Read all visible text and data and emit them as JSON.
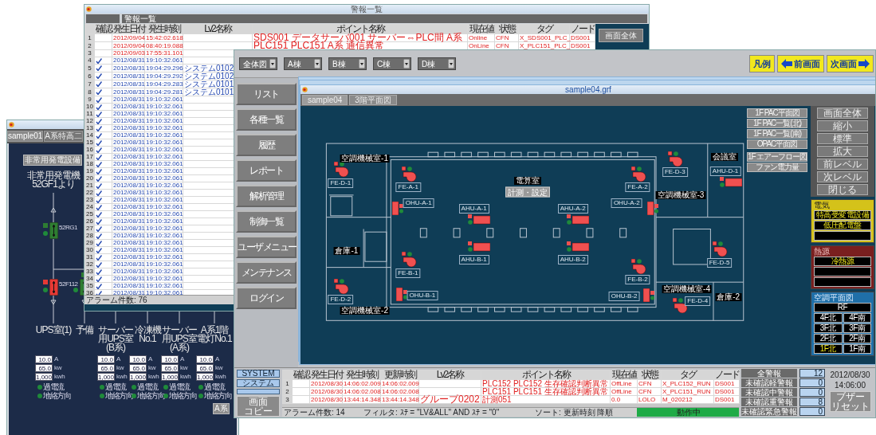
{
  "left_window": {
    "tabs": [
      {
        "label": "sample01",
        "selected": true
      },
      {
        "label": "A系特高二",
        "selected": false
      }
    ],
    "button": "非常用発電設備",
    "source_lines": [
      "非常用発電機",
      "52GF1より"
    ],
    "breakers": [
      {
        "label": "52RG1",
        "color": "#2e7d32"
      },
      {
        "label": "52F112",
        "color": "#e53935"
      },
      {
        "color": "#2e7d32"
      }
    ],
    "feeders": [
      {
        "name_lines": [
          "UPS室(1)"
        ],
        "readings": [
          {
            "value": "10.0",
            "unit": "A"
          },
          {
            "value": "65.0",
            "unit": "kw"
          },
          {
            "value": "1,000",
            "unit": "kwh"
          }
        ],
        "indicators": [
          "過電流",
          "地絡方向"
        ]
      },
      {
        "name_lines": [
          "予備"
        ]
      },
      {
        "name_lines": [
          "サーバー",
          "用UPS室",
          "(B系)"
        ],
        "readings": [
          {
            "value": "10.0",
            "unit": "A"
          },
          {
            "value": "65.0",
            "unit": "kw"
          },
          {
            "value": "1,000",
            "unit": "kwh"
          }
        ],
        "indicators": [
          "過電流",
          "地絡方向"
        ]
      },
      {
        "name_lines": [
          "冷凍機",
          "No.1"
        ],
        "readings": [
          {
            "value": "10.0",
            "unit": "A"
          },
          {
            "value": "65.0",
            "unit": "kw"
          },
          {
            "value": "1,000",
            "unit": "kwh"
          }
        ],
        "indicators": [
          "過電流",
          "地絡方向"
        ]
      },
      {
        "name_lines": [
          "サーバー",
          "用UPS室",
          "(A系)"
        ],
        "readings": [
          {
            "value": "10.0",
            "unit": "A"
          },
          {
            "value": "65.0",
            "unit": "kw"
          },
          {
            "value": "1,000",
            "unit": "kwh"
          }
        ],
        "indicators": [
          "過電流",
          "地絡方向"
        ]
      },
      {
        "name_lines": [
          "A系1階",
          "電灯No.1"
        ],
        "readings": [
          {
            "value": "10.0",
            "unit": "A"
          },
          {
            "value": "65.0",
            "unit": "kw"
          },
          {
            "value": "1,000",
            "unit": "kwh"
          }
        ],
        "indicators": [
          "過電流",
          "地絡方向"
        ]
      }
    ],
    "bottom_button": "A系"
  },
  "alarm_window": {
    "title": "警報一覧",
    "header": "警報一覧",
    "side_button": "画面全体",
    "columns": [
      "確認",
      "発生日付",
      "発生時刻",
      "Lv2名称",
      "ポイント名称",
      "現在値",
      "状態",
      "タグ",
      "ノード"
    ],
    "rows": [
      {
        "no": "1",
        "confirmed": false,
        "date": "2012/09/04",
        "time": "15:42:02.618",
        "point": "SDS001 データサーバ001 サーバー⇔PLC間 A系",
        "value": "Online",
        "state": "CFN",
        "tag": "X_SDS001_PLC_",
        "node": "DS001"
      },
      {
        "no": "2",
        "confirmed": false,
        "date": "2012/09/04",
        "time": "08:40:19.088",
        "point": "PLC151 PLC151 A系 通信異常",
        "value": "OnLine",
        "state": "CFN",
        "tag": "X_PLC151_PLC_",
        "node": "DS001"
      },
      {
        "no": "3",
        "confirmed": false,
        "date": "2012/09/03",
        "time": "17:55:31.101"
      },
      {
        "no": "4",
        "confirmed": true,
        "date": "2012/08/31",
        "time": "19:10:32.061"
      },
      {
        "no": "5",
        "confirmed": true,
        "date": "2012/08/31",
        "time": "19:04:29.296",
        "lv2": "システム0102"
      },
      {
        "no": "6",
        "confirmed": true,
        "date": "2012/08/31",
        "time": "19:04:29.292",
        "lv2": "システム0102"
      },
      {
        "no": "7",
        "confirmed": true,
        "date": "2012/08/31",
        "time": "19:04:29.283",
        "lv2": "システム0101"
      },
      {
        "no": "8",
        "confirmed": true,
        "date": "2012/08/31",
        "time": "19:04:29.281",
        "lv2": "システム0101"
      },
      {
        "no": "9",
        "confirmed": true,
        "date": "2012/08/31",
        "time": "19:10:32.061"
      },
      {
        "no": "10",
        "confirmed": true,
        "date": "2012/08/31",
        "time": "19:10:32.061"
      },
      {
        "no": "11",
        "confirmed": true,
        "date": "2012/08/31",
        "time": "19:10:32.061"
      },
      {
        "no": "12",
        "confirmed": true,
        "date": "2012/08/31",
        "time": "19:10:32.061"
      },
      {
        "no": "13",
        "confirmed": true,
        "date": "2012/08/31",
        "time": "19:10:32.061"
      },
      {
        "no": "14",
        "confirmed": true,
        "date": "2012/08/31",
        "time": "19:10:32.061"
      },
      {
        "no": "15",
        "confirmed": true,
        "date": "2012/08/31",
        "time": "19:10:32.061"
      },
      {
        "no": "16",
        "confirmed": true,
        "date": "2012/08/31",
        "time": "19:10:32.061"
      },
      {
        "no": "17",
        "confirmed": true,
        "date": "2012/08/31",
        "time": "19:10:32.061"
      },
      {
        "no": "18",
        "confirmed": true,
        "date": "2012/08/31",
        "time": "19:10:32.061"
      },
      {
        "no": "19",
        "confirmed": true,
        "date": "2012/08/31",
        "time": "19:10:32.061"
      },
      {
        "no": "20",
        "confirmed": true,
        "date": "2012/08/31",
        "time": "19:10:32.061"
      },
      {
        "no": "21",
        "confirmed": true,
        "date": "2012/08/31",
        "time": "19:10:32.061"
      },
      {
        "no": "22",
        "confirmed": true,
        "date": "2012/08/31",
        "time": "19:10:32.061"
      },
      {
        "no": "23",
        "confirmed": true,
        "date": "2012/08/31",
        "time": "19:10:32.061"
      },
      {
        "no": "24",
        "confirmed": true,
        "date": "2012/08/31",
        "time": "19:10:32.061"
      },
      {
        "no": "25",
        "confirmed": true,
        "date": "2012/08/31",
        "time": "19:10:32.061"
      },
      {
        "no": "26",
        "confirmed": true,
        "date": "2012/08/31",
        "time": "19:10:32.061"
      },
      {
        "no": "27",
        "confirmed": true,
        "date": "2012/08/31",
        "time": "19:10:32.061"
      },
      {
        "no": "28",
        "confirmed": true,
        "date": "2012/08/31",
        "time": "19:10:32.061"
      },
      {
        "no": "29",
        "confirmed": true,
        "date": "2012/08/31",
        "time": "19:10:32.061"
      },
      {
        "no": "30",
        "confirmed": true,
        "date": "2012/08/31",
        "time": "19:10:32.061"
      },
      {
        "no": "31",
        "confirmed": true,
        "date": "2012/08/31",
        "time": "19:10:32.061"
      },
      {
        "no": "32",
        "confirmed": true,
        "date": "2012/08/31",
        "time": "19:10:32.061"
      },
      {
        "no": "33",
        "confirmed": true,
        "date": "2012/08/31",
        "time": "19:10:32.061"
      },
      {
        "no": "34",
        "confirmed": true,
        "date": "2012/08/31",
        "time": "19:10:32.061"
      },
      {
        "no": "35",
        "confirmed": true,
        "date": "2012/08/31",
        "time": "19:10:32.061"
      },
      {
        "no": "36",
        "confirmed": true,
        "date": "2012/08/31",
        "time": "19:10:32.061"
      }
    ],
    "footer": "アラーム件数: 76"
  },
  "main_window": {
    "views": [
      "全体図",
      "A棟",
      "B棟",
      "C棟",
      "D棟"
    ],
    "nav_buttons": [
      {
        "kind": "legend",
        "label": "凡例"
      },
      {
        "kind": "back",
        "label": "前画面"
      },
      {
        "kind": "forward",
        "label": "次画面"
      }
    ],
    "menu": [
      "リスト",
      "各種一覧",
      "履歴",
      "レポート",
      "解析管理",
      "制御一覧",
      "ユーザメニュー",
      "メンテナンス",
      "ログイン"
    ],
    "sub_window": {
      "title": "sample04.grf",
      "tabs": [
        {
          "label": "sample04",
          "selected": true
        },
        {
          "label": "3階平面図",
          "selected": false
        }
      ],
      "labels": [
        {
          "kind": "room",
          "text": "空調機械室-1"
        },
        {
          "kind": "equipment",
          "text": "FE-D-1"
        },
        {
          "kind": "equipment",
          "text": "FE-A-1"
        },
        {
          "kind": "room",
          "text": "電算室"
        },
        {
          "kind": "equipment",
          "text": "FE-A-2"
        },
        {
          "kind": "equipment",
          "text": "FE-D-3"
        },
        {
          "kind": "room",
          "text": "会議室"
        },
        {
          "kind": "equipment",
          "text": "AHU-D-1"
        },
        {
          "kind": "room",
          "text": "空調機械室-3"
        },
        {
          "kind": "equipment",
          "text": "OHU-A-1"
        },
        {
          "kind": "equipment",
          "text": "AHU-A-1"
        },
        {
          "kind": "equipment",
          "text": "AHU-A-2"
        },
        {
          "kind": "equipment",
          "text": "OHU-A-2"
        },
        {
          "kind": "room",
          "text": "倉庫-1"
        },
        {
          "kind": "equipment",
          "text": "AHU-B-1"
        },
        {
          "kind": "equipment",
          "text": "AHU-B-2"
        },
        {
          "kind": "equipment",
          "text": "FE-B-1"
        },
        {
          "kind": "equipment",
          "text": "FE-B-2"
        },
        {
          "kind": "equipment",
          "text": "FE-D-5"
        },
        {
          "kind": "equipment",
          "text": "FE-D-2"
        },
        {
          "kind": "equipment",
          "text": "OHU-B-1"
        },
        {
          "kind": "equipment",
          "text": "OHU-B-2"
        },
        {
          "kind": "room",
          "text": "空調機械室-4"
        },
        {
          "kind": "equipment",
          "text": "FE-D-4"
        },
        {
          "kind": "room",
          "text": "倉庫-2"
        },
        {
          "kind": "room",
          "text": "空調機械室-2"
        }
      ],
      "measure_button": "計測・設定",
      "plan_buttons": [
        "1F PAC平面図",
        "1F PAC一覧(北)",
        "1F PAC一覧(南)",
        "OPAC平面図",
        "1F エアーフロー図",
        "ファン電力量"
      ],
      "view_buttons": [
        "画面全体",
        "縮小",
        "標準",
        "拡大",
        "前レベル",
        "次レベル",
        "閉じる"
      ],
      "panels": [
        {
          "kind": "electric",
          "title": "電気",
          "buttons": [
            "特高受変電設備",
            "低圧配電盤"
          ]
        },
        {
          "kind": "heat",
          "title": "熱源",
          "buttons": [
            "冷熱源"
          ]
        },
        {
          "kind": "hvac",
          "title": "空調平面図",
          "roof": "RF",
          "floors": [
            {
              "label": "4F北",
              "selected": false
            },
            {
              "label": "4F南",
              "selected": false
            },
            {
              "label": "3F北",
              "selected": false
            },
            {
              "label": "3F南",
              "selected": false
            },
            {
              "label": "2F北",
              "selected": false
            },
            {
              "label": "2F南",
              "selected": false
            },
            {
              "label": "1F北",
              "selected": true
            },
            {
              "label": "1F南",
              "selected": false
            }
          ]
        }
      ]
    },
    "side_buttons": [
      {
        "kind": "tab",
        "lines": [
          "SYSTEM"
        ]
      },
      {
        "kind": "tab",
        "lines": [
          "システム"
        ]
      },
      {
        "kind": "tab"
      },
      {
        "kind": "action",
        "lines": [
          "画面",
          "コピー"
        ]
      }
    ],
    "alarm_table": {
      "columns": [
        "確認",
        "発生日付",
        "発生時刻",
        "更新時刻",
        "Lv2名称",
        "ポイント名称",
        "現在値",
        "状態",
        "タグ",
        "ノード"
      ],
      "rows": [
        {
          "no": "1",
          "date": "2012/08/30",
          "time": "14:06:02.009",
          "updated": "14:06:02.009",
          "point": "PLC152 PLC152 生存確認判断異常",
          "value": "OffLine",
          "state": "CFN",
          "tag": "X_PLC152_RUN",
          "node": "DS001"
        },
        {
          "no": "2",
          "date": "2012/08/30",
          "time": "14:06:02.008",
          "updated": "14:06:02.008",
          "point": "PLC151 PLC151 生存確認判断異常",
          "value": "OffLine",
          "state": "CFN",
          "tag": "X_PLC151_RUN",
          "node": "DS001"
        },
        {
          "no": "3",
          "date": "2012/08/30",
          "time": "13:44:14.348",
          "updated": "13:44:14.348",
          "lv2": "グループ0202",
          "point": "計測051",
          "value": "0.0",
          "state": "LOLO",
          "tag": "M_020212",
          "node": "DS001"
        }
      ],
      "count": "アラーム件数: 14",
      "filter": "フィルタ: ｽﾃ = \"LV&ALL\" AND ｽﾃ = \"0\"",
      "sort": "ソート: 更新時刻 降順",
      "status": "動作中"
    },
    "counters": [
      {
        "label": "全警報",
        "value": "12"
      },
      {
        "label": "未確認軽警報",
        "value": "0"
      },
      {
        "label": "未確認中警報",
        "value": "0"
      },
      {
        "label": "未確認重警報",
        "value": "8"
      },
      {
        "label": "未確認緊急警報",
        "value": "0"
      }
    ],
    "clock": {
      "date": "2012/08/30",
      "time": "14:06:00"
    },
    "buzzer_lines": [
      "ブザー",
      "リセット"
    ]
  }
}
